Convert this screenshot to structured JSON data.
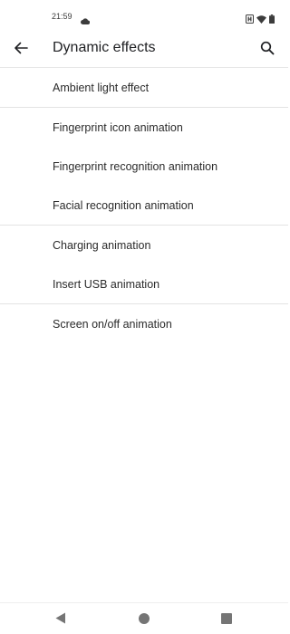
{
  "status_bar": {
    "time": "21:59",
    "left_icon": "cloud-icon",
    "right_icons": [
      "sim-icon",
      "wifi-icon",
      "battery-icon"
    ]
  },
  "header": {
    "title": "Dynamic effects",
    "back_icon": "back-arrow-icon",
    "search_icon": "search-icon"
  },
  "list": {
    "items": [
      {
        "label": "Ambient light effect"
      },
      {
        "label": "Fingerprint icon animation"
      },
      {
        "label": "Fingerprint recognition animation"
      },
      {
        "label": "Facial recognition animation"
      },
      {
        "label": "Charging animation"
      },
      {
        "label": "Insert USB animation"
      },
      {
        "label": "Screen on/off animation"
      }
    ]
  },
  "nav_bar": {
    "buttons": [
      "nav-back-icon",
      "nav-home-icon",
      "nav-recents-icon"
    ]
  },
  "colors": {
    "background": "#ffffff",
    "text": "#202124",
    "divider": "#e3e3e3",
    "nav_icon": "#757575"
  }
}
